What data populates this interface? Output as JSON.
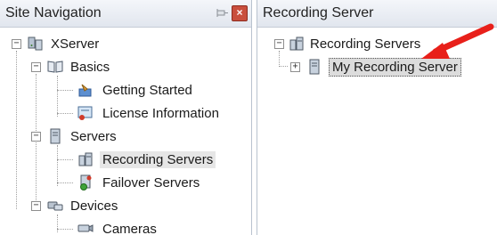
{
  "left_panel": {
    "title": "Site Navigation",
    "tree": {
      "root": "XServer",
      "basics": "Basics",
      "getting_started": "Getting Started",
      "license_information": "License Information",
      "servers": "Servers",
      "recording_servers": "Recording Servers",
      "failover_servers": "Failover Servers",
      "devices": "Devices",
      "cameras": "Cameras"
    }
  },
  "right_panel": {
    "title": "Recording Server",
    "tree": {
      "root": "Recording Servers",
      "child": "My Recording Server"
    }
  },
  "colors": {
    "annotation_arrow": "#e8201a",
    "selection": "#e6e6e6"
  },
  "icons": [
    "pin-icon",
    "close-icon",
    "server-group-icon",
    "book-icon",
    "getting-started-icon",
    "license-icon",
    "server-icon",
    "recording-servers-icon",
    "failover-servers-icon",
    "devices-icon",
    "camera-icon"
  ]
}
